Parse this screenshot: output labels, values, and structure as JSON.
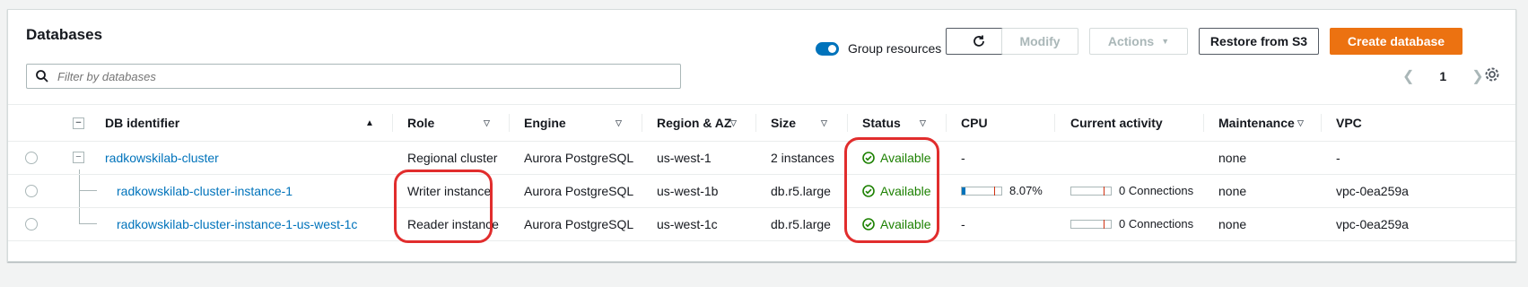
{
  "header": {
    "title": "Databases",
    "group_resources_label": "Group resources",
    "modify_label": "Modify",
    "actions_label": "Actions",
    "restore_label": "Restore from S3",
    "create_label": "Create database"
  },
  "search": {
    "placeholder": "Filter by databases"
  },
  "pagination": {
    "page": "1"
  },
  "columns": {
    "db_identifier": "DB identifier",
    "role": "Role",
    "engine": "Engine",
    "region": "Region & AZ",
    "size": "Size",
    "status": "Status",
    "cpu": "CPU",
    "activity": "Current activity",
    "maintenance": "Maintenance",
    "vpc": "VPC"
  },
  "rows": [
    {
      "identifier": "radkowskilab-cluster",
      "role": "Regional cluster",
      "engine": "Aurora PostgreSQL",
      "region": "us-west-1",
      "size": "2 instances",
      "status": "Available",
      "cpu": "-",
      "activity": "",
      "maintenance": "none",
      "vpc": "-"
    },
    {
      "identifier": "radkowskilab-cluster-instance-1",
      "role": "Writer instance",
      "engine": "Aurora PostgreSQL",
      "region": "us-west-1b",
      "size": "db.r5.large",
      "status": "Available",
      "cpu": "8.07%",
      "cpu_fraction": 0.0807,
      "activity": "0 Connections",
      "maintenance": "none",
      "vpc": "vpc-0ea259a"
    },
    {
      "identifier": "radkowskilab-cluster-instance-1-us-west-1c",
      "role": "Reader instance",
      "engine": "Aurora PostgreSQL",
      "region": "us-west-1c",
      "size": "db.r5.large",
      "status": "Available",
      "cpu": "-",
      "activity": "0 Connections",
      "maintenance": "none",
      "vpc": "vpc-0ea259a"
    }
  ],
  "colors": {
    "accent": "#0073bb",
    "primary_button": "#ec7211",
    "status_ok": "#1d8102",
    "annotation": "#e12d2d"
  }
}
